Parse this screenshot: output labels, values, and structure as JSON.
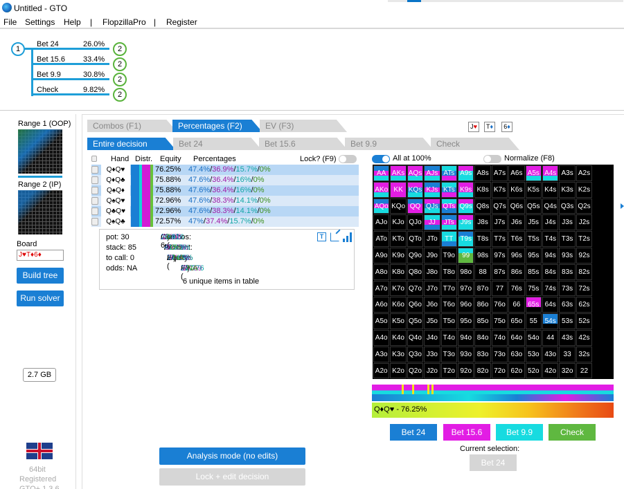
{
  "window": {
    "title": "Untitled - GTO"
  },
  "menu": [
    "File",
    "Settings",
    "Help",
    "|",
    "FlopzillaPro",
    "|",
    "Register"
  ],
  "tree": {
    "root": "1",
    "child": "2",
    "actions": [
      {
        "label": "Bet 24",
        "pct": "26.0%"
      },
      {
        "label": "Bet 15.6",
        "pct": "33.4%"
      },
      {
        "label": "Bet 9.9",
        "pct": "30.8%"
      },
      {
        "label": "Check",
        "pct": "9.82%"
      }
    ]
  },
  "left": {
    "range1": "Range 1 (OOP)",
    "range2": "Range 2 (IP)",
    "board_label": "Board",
    "board_value": "J♥T♦6♦",
    "build_tree": "Build tree",
    "run_solver": "Run solver",
    "memory": "2.7 GB",
    "version": "64bit",
    "registered": "Registered",
    "footer": "GTO+ 1.3.6"
  },
  "tabs_top": [
    {
      "label": "Combos (F1)",
      "active": false
    },
    {
      "label": "Percentages (F2)",
      "active": true
    },
    {
      "label": "EV (F3)",
      "active": false
    }
  ],
  "tabs_actions": [
    {
      "label": "Entire decision",
      "active": true
    },
    {
      "label": "Bet 24",
      "active": false
    },
    {
      "label": "Bet 15.6",
      "active": false
    },
    {
      "label": "Bet 9.9",
      "active": false
    },
    {
      "label": "Check",
      "active": false
    }
  ],
  "board_cards": [
    {
      "rank": "J",
      "suit": "♥",
      "color": "#d00"
    },
    {
      "rank": "T",
      "suit": "♦",
      "color": "#1a6fc4"
    },
    {
      "rank": "6",
      "suit": "♦",
      "color": "#1a6fc4"
    }
  ],
  "table": {
    "headers": {
      "hand": "Hand",
      "distr": "Distr.",
      "equity": "Equity",
      "percentages": "Percentages",
      "lock": "Lock? (F9)"
    },
    "rows": [
      {
        "hand": "Q♦Q♥",
        "equity": "76.25%",
        "p1": "47.4%",
        "p2": "36.9%",
        "p3": "15.7%",
        "p4": "0%"
      },
      {
        "hand": "Q♦Q♣",
        "equity": "75.88%",
        "p1": "47.6%",
        "p2": "36.4%",
        "p3": "16%",
        "p4": "0%"
      },
      {
        "hand": "Q♠Q♦",
        "equity": "75.88%",
        "p1": "47.6%",
        "p2": "36.4%",
        "p3": "16%",
        "p4": "0%"
      },
      {
        "hand": "Q♠Q♥",
        "equity": "72.96%",
        "p1": "47.6%",
        "p2": "38.3%",
        "p3": "14.1%",
        "p4": "0%"
      },
      {
        "hand": "Q♣Q♥",
        "equity": "72.96%",
        "p1": "47.6%",
        "p2": "38.3%",
        "p3": "14.1%",
        "p4": "0%"
      },
      {
        "hand": "Q♠Q♣",
        "equity": "72.57%",
        "p1": "47%",
        "p2": "37.4%",
        "p3": "15.7%",
        "p4": "0%"
      }
    ]
  },
  "info": {
    "pot": "pot: 30",
    "stack": "stack: 85",
    "tocall": "to call: 0",
    "odds": "odds: NA",
    "combos_label": "Combos: 6 (",
    "combos_vals": [
      "2.847",
      "2.238",
      "0.916",
      "0"
    ],
    "percent_label": "Percent:",
    "percent_vals": [
      "47.4%",
      "37.3%",
      "15.3%",
      "0%"
    ],
    "equity_label": "Equity:",
    "equity_main": "74.43% (",
    "equity_vals": [
      "74.4%",
      "74.4%",
      "74.5%",
      "NA"
    ],
    "ev_label": "EV:",
    "ev_main": "27.7 (",
    "ev_vals": [
      "27.7",
      "27.69",
      "27.76",
      "NA"
    ],
    "unique": "6 unique items in table"
  },
  "toggles": {
    "all100": "All at 100%",
    "normalize": "Normalize (F8)"
  },
  "selection_bar": "Q♦Q♥ - 76.25%",
  "action_buttons": [
    {
      "label": "Bet 24",
      "color": "#1a7fd4"
    },
    {
      "label": "Bet 15.6",
      "color": "#e21de4"
    },
    {
      "label": "Bet 9.9",
      "color": "#17dbe0"
    },
    {
      "label": "Check",
      "color": "#5fb840"
    }
  ],
  "current_selection_label": "Current selection:",
  "current_selection_value": "Bet 24",
  "analysis_button": "Analysis mode (no edits)",
  "lock_button": "Lock + edit decision",
  "matrix": [
    [
      "AA",
      "AKs",
      "AQs",
      "AJs",
      "ATs",
      "A9s",
      "A8s",
      "A7s",
      "A6s",
      "A5s",
      "A4s",
      "A3s",
      "A2s"
    ],
    [
      "AKo",
      "KK",
      "KQs",
      "KJs",
      "KTs",
      "K9s",
      "K8s",
      "K7s",
      "K6s",
      "K5s",
      "K4s",
      "K3s",
      "K2s"
    ],
    [
      "AQo",
      "KQo",
      "QQ",
      "QJs",
      "QTs",
      "Q9s",
      "Q8s",
      "Q7s",
      "Q6s",
      "Q5s",
      "Q4s",
      "Q3s",
      "Q2s"
    ],
    [
      "AJo",
      "KJo",
      "QJo",
      "JJ",
      "JTs",
      "J9s",
      "J8s",
      "J7s",
      "J6s",
      "J5s",
      "J4s",
      "J3s",
      "J2s"
    ],
    [
      "ATo",
      "KTo",
      "QTo",
      "JTo",
      "TT",
      "T9s",
      "T8s",
      "T7s",
      "T6s",
      "T5s",
      "T4s",
      "T3s",
      "T2s"
    ],
    [
      "A9o",
      "K9o",
      "Q9o",
      "J9o",
      "T9o",
      "99",
      "98s",
      "97s",
      "96s",
      "95s",
      "94s",
      "93s",
      "92s"
    ],
    [
      "A8o",
      "K8o",
      "Q8o",
      "J8o",
      "T8o",
      "98o",
      "88",
      "87s",
      "86s",
      "85s",
      "84s",
      "83s",
      "82s"
    ],
    [
      "A7o",
      "K7o",
      "Q7o",
      "J7o",
      "T7o",
      "97o",
      "87o",
      "77",
      "76s",
      "75s",
      "74s",
      "73s",
      "72s"
    ],
    [
      "A6o",
      "K6o",
      "Q6o",
      "J6o",
      "T6o",
      "96o",
      "86o",
      "76o",
      "66",
      "65s",
      "64s",
      "63s",
      "62s"
    ],
    [
      "A5o",
      "K5o",
      "Q5o",
      "J5o",
      "T5o",
      "95o",
      "85o",
      "75o",
      "65o",
      "55",
      "54s",
      "53s",
      "52s"
    ],
    [
      "A4o",
      "K4o",
      "Q4o",
      "J4o",
      "T4o",
      "94o",
      "84o",
      "74o",
      "64o",
      "54o",
      "44",
      "43s",
      "42s"
    ],
    [
      "A3o",
      "K3o",
      "Q3o",
      "J3o",
      "T3o",
      "93o",
      "83o",
      "73o",
      "63o",
      "53o",
      "43o",
      "33",
      "32s"
    ],
    [
      "A2o",
      "K2o",
      "Q2o",
      "J2o",
      "T2o",
      "92o",
      "82o",
      "72o",
      "62o",
      "52o",
      "42o",
      "32o",
      "22"
    ]
  ],
  "colored_cells": {
    "AA": [
      "#1a7fd4",
      "#e21de4",
      "#17dbe0"
    ],
    "AKs": [
      "#e21de4",
      "#e21de4",
      "#17dbe0"
    ],
    "AQs": [
      "#e21de4",
      "#e21de4",
      "#17dbe0"
    ],
    "AJs": [
      "#1a7fd4",
      "#e21de4",
      "#17dbe0"
    ],
    "ATs": [
      "#17dbe0",
      "#1a7fd4",
      "#e21de4"
    ],
    "A9s": [
      "#e21de4",
      "#17dbe0",
      "#17dbe0"
    ],
    "AKo": [
      "#e21de4",
      "#e21de4",
      "#17dbe0"
    ],
    "KK": [
      "#e21de4",
      "#e21de4",
      "#e21de4"
    ],
    "KQs": [
      "#e21de4",
      "#1a7fd4",
      "#17dbe0"
    ],
    "KJs": [
      "#1a7fd4",
      "#e21de4",
      "#17dbe0"
    ],
    "KTs": [
      "#17dbe0",
      "#1a7fd4",
      "#e21de4"
    ],
    "K9s": [
      "#e21de4",
      "#e21de4",
      "#17dbe0"
    ],
    "AQo": [
      "#1a7fd4",
      "#e21de4",
      "#17dbe0"
    ],
    "QQ": [
      "#1a7fd4",
      "#e21de4",
      "#e21de4"
    ],
    "QJs": [
      "#e21de4",
      "#1a7fd4",
      "#17dbe0"
    ],
    "QTs": [
      "#17dbe0",
      "#e21de4",
      "#1a7fd4"
    ],
    "Q9s": [
      "#e21de4",
      "#17dbe0",
      "#17dbe0"
    ],
    "JJ": [
      "#17dbe0",
      "#e21de4",
      "#1a7fd4"
    ],
    "JTs": [
      "#1a7fd4",
      "#e21de4",
      "#17dbe0"
    ],
    "J9s": [
      "#e21de4",
      "#17dbe0",
      "#17dbe0"
    ],
    "TT": [
      "#17dbe0",
      "#17dbe0",
      "#1a7fd4"
    ],
    "T9s": [
      "#1a7fd4",
      "#17dbe0",
      "#17dbe0"
    ],
    "99": [
      "#17dbe0",
      "#5fb840",
      "#5fb840"
    ],
    "A5s": [
      "#e21de4",
      "#e21de4",
      "#17dbe0"
    ],
    "A4s": [
      "#e21de4",
      "#e21de4",
      "#17dbe0"
    ],
    "65s": [
      "#e21de4",
      "#e21de4",
      "#000000"
    ],
    "54s": [
      "#1a7fd4",
      "#1a7fd4",
      "#000000"
    ]
  }
}
